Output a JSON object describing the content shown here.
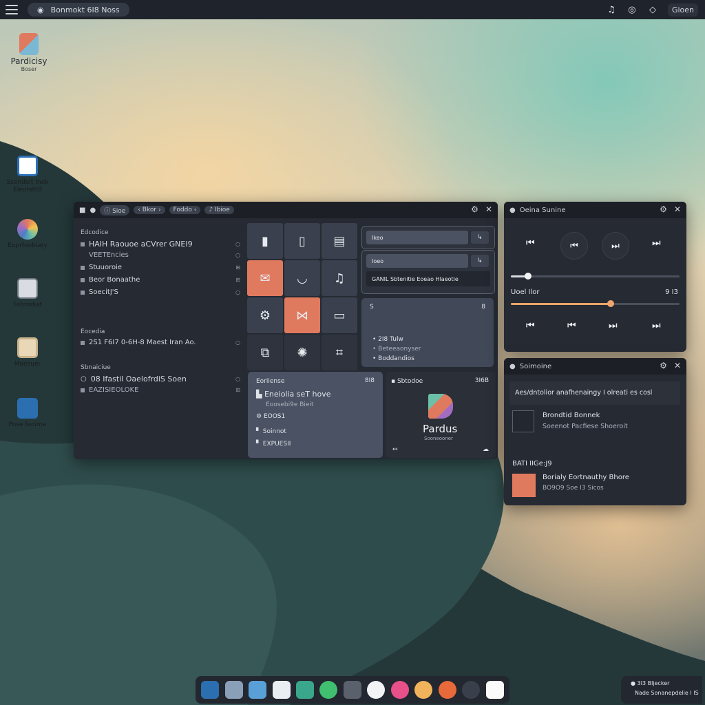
{
  "topbar": {
    "pill_text": "Bonmokt 6I8 Noss",
    "right_label": "Gioen",
    "icons": [
      "menu-icon",
      "search-icon",
      "music-icon",
      "camera-icon",
      "diamond-icon"
    ]
  },
  "desktop": {
    "logo": {
      "title": "Pardicisy",
      "subtitle": "Boser"
    },
    "icons": [
      {
        "label": "Ssendoit Inek Eleotsltl8",
        "icon": "document-p-icon"
      },
      {
        "label": "Eoprfonbiaty",
        "icon": "palette-icon"
      },
      {
        "label": "Ssbrodiat",
        "icon": "calculator-icon"
      },
      {
        "label": "Moesuer",
        "icon": "package-icon"
      },
      {
        "label": "Pose feoime",
        "icon": "folder-icon"
      }
    ]
  },
  "main_window": {
    "tabs": [
      "Sioe",
      "Bkor",
      "Foddo",
      "Ibioe"
    ],
    "sidebar": {
      "section1": {
        "title": "Edcodice",
        "items": [
          "HAIH Raouoe aCVrer GNEI9",
          "VEETEncies",
          "Stuuoroie",
          "Beor Bonaathe",
          "SoecitJ'S"
        ]
      },
      "section2": {
        "title": "Eocedia",
        "items": [
          "2S1 F6I7 0-6H-8 Maest Iran Ao."
        ]
      },
      "section3": {
        "title": "Sbnaiciue",
        "items": [
          "08 Ifastil OaelofrdiS Soen",
          "EAZISIEOLOKE"
        ]
      }
    },
    "right_top": {
      "field1": "Ikeo",
      "field2": "Ioeo",
      "note": "GANIL Sbtenitie Eoeao Hlaeotie",
      "card_header": "S",
      "card_badge": "8",
      "card_lines": [
        "2I8 Tulw",
        "Beteeaonyser",
        "Boddandios"
      ]
    },
    "bottom_left": {
      "header": "Eoriiense",
      "header_right": "8I8",
      "title": "Eneiolia seT hove",
      "subtitle": "Eoosebi9e Bieit",
      "line1": "EOOS1",
      "line2": "Soinnot",
      "line3": "EXPUESII"
    },
    "bottom_right": {
      "header": "Sbtodoe",
      "header_right": "3I6B",
      "app_name": "Pardus",
      "app_sub": "Sooneooner"
    }
  },
  "media_player": {
    "title": "Oeina Sunine",
    "progress1": 0.1,
    "track_label": "Uoel Ilor",
    "track_time": "9 I3",
    "progress2": 0.59
  },
  "notif_panel": {
    "title": "Soimoine",
    "search_text": "Aes/dntolior anafhenaingy I olreati es cosl",
    "item1": {
      "title": "Brondtid Bonnek",
      "sub": "Soeenot Pacfiese Shoeroit"
    },
    "section": "BATI IIGe:J9",
    "item2": {
      "title": "Borialy Eortnauthy Bhore",
      "sub": "BO9O9 Soe I3 Sicos"
    }
  },
  "system_tray": {
    "line1": "3I3 Bljecker",
    "line2": "Nade Sonanepdelie I IS"
  },
  "colors": {
    "accent": "#e07a5f",
    "window_bg": "#262a33",
    "titlebar_bg": "#1c1f26",
    "slider_track": "#e8a46a"
  }
}
